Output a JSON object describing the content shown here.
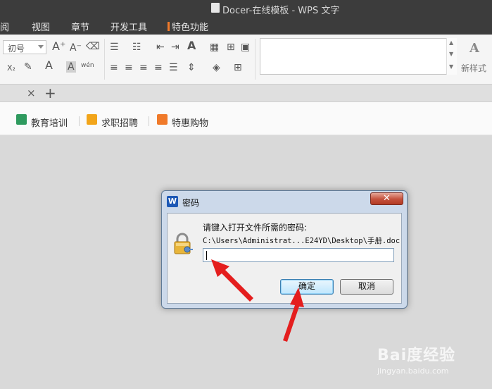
{
  "window": {
    "title": "Docer-在线模板 - WPS 文字"
  },
  "menu": {
    "items": [
      {
        "label": "阅"
      },
      {
        "label": "视图"
      },
      {
        "label": "章节"
      },
      {
        "label": "开发工具"
      },
      {
        "label": "特色功能"
      }
    ]
  },
  "ribbon": {
    "font_size": "初号",
    "new_style_label": "新样式"
  },
  "tabs": {
    "close_glyph": "×",
    "add_glyph": "+"
  },
  "docer": {
    "items": [
      {
        "label": "教育培训",
        "color": "#2e9a5e"
      },
      {
        "label": "求职招聘",
        "color": "#f2a51a"
      },
      {
        "label": "特惠购物",
        "color": "#f07a2a"
      }
    ]
  },
  "dialog": {
    "title": "密码",
    "close_glyph": "✕",
    "prompt": "请键入打开文件所需的密码:",
    "path": "C:\\Users\\Administrat...E24YD\\Desktop\\手册.doc",
    "password_value": "",
    "ok_label": "确定",
    "cancel_label": "取消"
  },
  "watermark": {
    "brand": "Bai度经验",
    "url": "jingyan.baidu.com"
  },
  "colors": {
    "titlebar": "#3c3c3c",
    "arrow": "#e41e1e",
    "accent_green": "#2e9a5e"
  }
}
